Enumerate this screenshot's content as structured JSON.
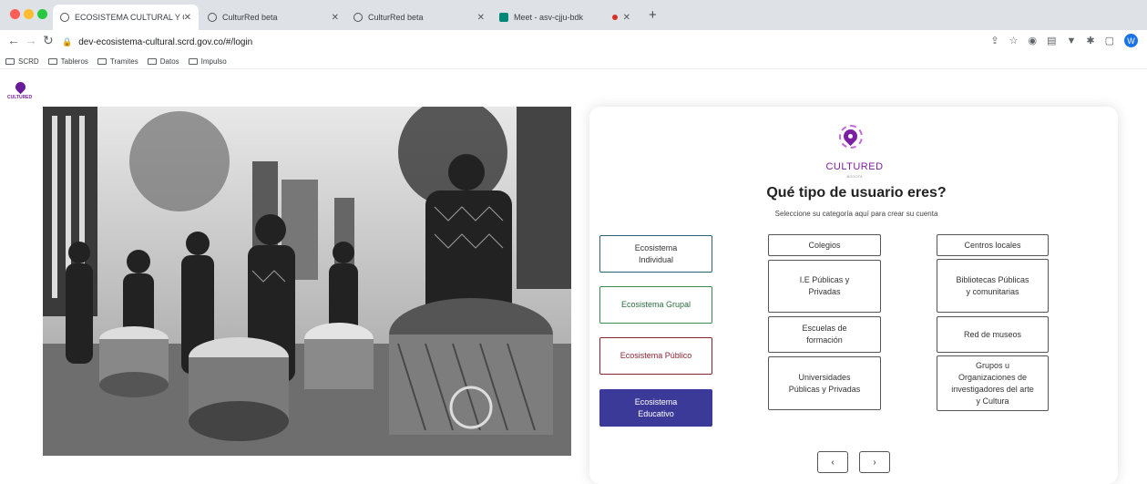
{
  "browser": {
    "tabs": [
      {
        "label": "ECOSISTEMA CULTURAL Y C",
        "active": true
      },
      {
        "label": "CulturRed beta",
        "active": false
      },
      {
        "label": "CulturRed beta",
        "active": false
      },
      {
        "label": "Meet - asv-cjju-bdk",
        "active": false
      }
    ],
    "url": "dev-ecosistema-cultural.scrd.gov.co/#/login",
    "profile_initial": "W",
    "bookmarks": [
      "SCRD",
      "Tableros",
      "Tramites",
      "Datos",
      "Impulso"
    ]
  },
  "page": {
    "mini_logo": "CULTURED",
    "logo": {
      "name": "CULTURED",
      "tagline": "BOGOTÁ"
    },
    "title": "Qué tipo de usuario eres?",
    "subtitle": "Seleccione su categoría aquí para crear su cuenta",
    "categories": [
      "Ecosistema Individual",
      "Ecosistema Grupal",
      "Ecosistema Público",
      "Ecosistema Educativo"
    ],
    "middle_options": [
      "Colegios",
      "I.E Públicas y Privadas",
      "Escuelas de formación",
      "Universidades Públicas y Privadas"
    ],
    "right_options": [
      "Centros locales",
      "Bibliotecas Públicas y comunitarias",
      "Red de museos",
      "Grupos u Organizaciones de investigadores del arte y Cultura"
    ],
    "pager_prev": "‹",
    "pager_next": "›"
  },
  "colors": {
    "accent": "#3c3a98",
    "brand": "#7b1fa2",
    "grupal": "#3b8a52",
    "publico": "#8e2330"
  }
}
